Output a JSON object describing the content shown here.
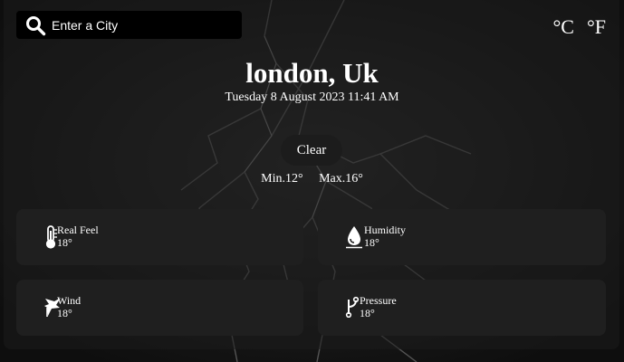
{
  "search": {
    "placeholder": "Enter a City"
  },
  "units": {
    "celsius": "°C",
    "fahrenheit": "°F"
  },
  "location": {
    "city": "london, Uk",
    "datetime": "Tuesday 8 August 2023 11:41 AM"
  },
  "condition": "Clear",
  "temps": {
    "min": "Min.12°",
    "max": "Max.16°"
  },
  "details": {
    "real_feel": {
      "label": "Real Feel",
      "value": "18°"
    },
    "humidity": {
      "label": "Humidity",
      "value": "18°"
    },
    "wind": {
      "label": "Wind",
      "value": "18°"
    },
    "pressure": {
      "label": "Pressure",
      "value": "18°"
    }
  }
}
